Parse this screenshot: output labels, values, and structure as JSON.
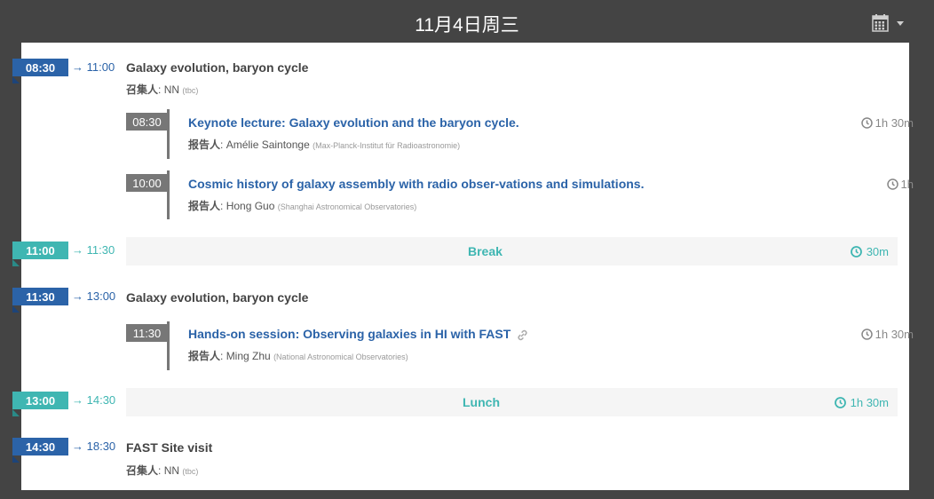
{
  "header": {
    "title": "11月4日周三",
    "calendar_icon": "calendar-icon"
  },
  "colors": {
    "block": "#2b63a8",
    "break": "#3fb6b2",
    "contrib": "#777777",
    "background": "#444444"
  },
  "labels": {
    "convener": "召集人",
    "speaker": "报告人",
    "arrow": "→"
  },
  "blocks": [
    {
      "start": "08:30",
      "end": "11:00",
      "title": "Galaxy evolution, baryon cycle",
      "convener_name": "NN",
      "convener_note": "(tbc)",
      "contributions": [
        {
          "time": "08:30",
          "title": "Keynote lecture: Galaxy evolution and the baryon cycle.",
          "speaker_name": "Amélie Saintonge",
          "affiliation": "(Max-Planck-Institut für Radioastronomie)",
          "duration": "1h 30m"
        },
        {
          "time": "10:00",
          "title": "Cosmic history of galaxy assembly with radio obser-vations and simulations.",
          "speaker_name": "Hong Guo",
          "affiliation": "(Shanghai Astronomical Observatories)",
          "duration": "1h"
        }
      ]
    },
    {
      "start": "11:30",
      "end": "13:00",
      "title": "Galaxy evolution, baryon cycle",
      "contributions": [
        {
          "time": "11:30",
          "title": "Hands-on session: Observing galaxies in HI with FAST",
          "speaker_name": "Ming Zhu",
          "affiliation": "(National Astronomical Observatories)",
          "duration": "1h 30m"
        }
      ]
    },
    {
      "start": "14:30",
      "end": "18:30",
      "title": "FAST Site visit",
      "convener_name": "NN",
      "convener_note": "(tbc)"
    }
  ],
  "breaks": [
    {
      "start": "11:00",
      "end": "11:30",
      "title": "Break",
      "duration": "30m"
    },
    {
      "start": "13:00",
      "end": "14:30",
      "title": "Lunch",
      "duration": "1h 30m"
    }
  ]
}
